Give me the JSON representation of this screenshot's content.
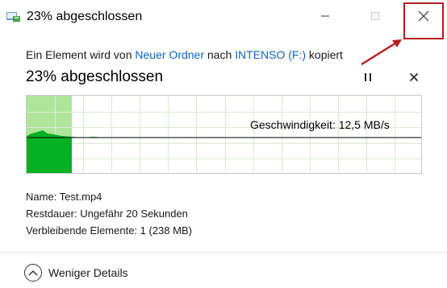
{
  "window": {
    "title": "23% abgeschlossen",
    "icon": "copy-window-icon",
    "controls": {
      "minimize_icon": "minimize-icon",
      "maximize_icon": "maximize-icon",
      "close_icon": "close-icon"
    }
  },
  "copy": {
    "desc_prefix": "Ein Element wird von ",
    "source": "Neuer Ordner",
    "desc_mid": " nach ",
    "destination": "INTENSO (F:)",
    "desc_suffix": " kopiert"
  },
  "progress": {
    "heading": "23% abgeschlossen",
    "percent": 23,
    "pause_icon": "pause-icon",
    "cancel_icon": "cancel-icon",
    "speed_label": "Geschwindigkeit: 12,5 MB/s"
  },
  "details": {
    "name": "Name: Test.mp4",
    "remaining_time": "Restdauer: Ungefähr 20 Sekunden",
    "remaining_items": "Verbleibende Elemente: 1 (238 MB)"
  },
  "footer": {
    "toggle_label": "Weniger Details",
    "toggle_icon": "chevron-up-icon"
  },
  "colors": {
    "progress_fill": "#aee59b",
    "speed_fill": "#06b025",
    "link": "#0a66c2",
    "highlight": "#b81c1c"
  }
}
